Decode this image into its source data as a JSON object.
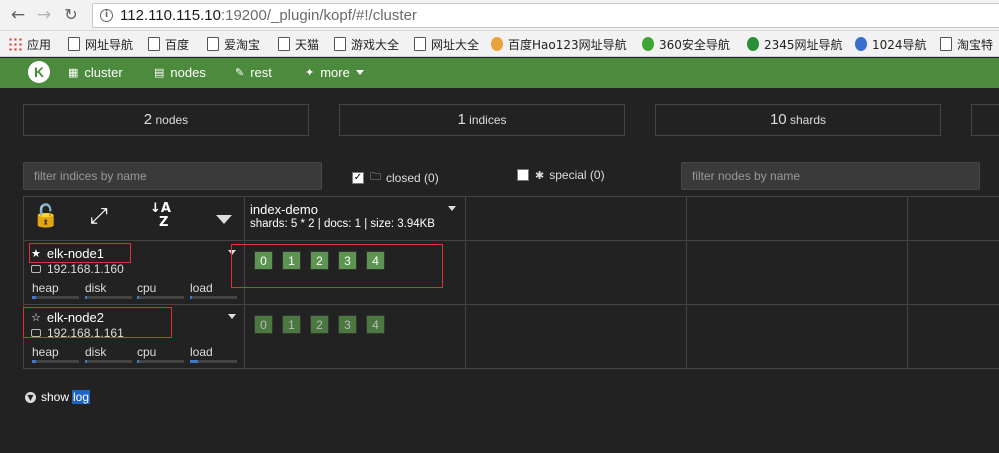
{
  "browser": {
    "url_host": "112.110.115.10",
    "url_rest": ":19200/_plugin/kopf/#!/cluster",
    "bookmarks": [
      "应用",
      "网址导航",
      "百度",
      "爱淘宝",
      "天猫",
      "游戏大全",
      "网址大全",
      "百度Hao123网址导航",
      "360安全导航",
      "2345网址导航",
      "1024导航",
      "淘宝特"
    ]
  },
  "nav": {
    "logo": "K",
    "items": [
      "cluster",
      "nodes",
      "rest",
      "more"
    ]
  },
  "stats": [
    {
      "num": "2",
      "label": "nodes"
    },
    {
      "num": "1",
      "label": "indices"
    },
    {
      "num": "10",
      "label": "shards"
    }
  ],
  "filters": {
    "indices_placeholder": "filter indices by name",
    "closed_label": "closed (0)",
    "special_label": "special (0)",
    "nodes_placeholder": "filter nodes by name"
  },
  "index": {
    "name": "index-demo",
    "meta": "shards: 5 * 2 | docs: 1 | size: 3.94KB"
  },
  "nodes": [
    {
      "name": "elk-node1",
      "ip": "192.168.1.160",
      "master": true,
      "metrics": {
        "heap": 0.08,
        "disk": 0.04,
        "cpu": 0.04,
        "load": 0.04
      },
      "shards": [
        "0",
        "1",
        "2",
        "3",
        "4"
      ],
      "shard_type": "primary"
    },
    {
      "name": "elk-node2",
      "ip": "192.168.1.161",
      "master": false,
      "metrics": {
        "heap": 0.08,
        "disk": 0.04,
        "cpu": 0.04,
        "load": 0.18
      },
      "shards": [
        "0",
        "1",
        "2",
        "3",
        "4"
      ],
      "shard_type": "replica"
    }
  ],
  "metric_labels": [
    "heap",
    "disk",
    "cpu",
    "load"
  ],
  "footer": {
    "show": "show",
    "log": "log"
  },
  "colors": {
    "navbar": "#4c8a3d",
    "background": "#222222",
    "shard_primary": "#5e9451",
    "highlight": "#e03030"
  }
}
